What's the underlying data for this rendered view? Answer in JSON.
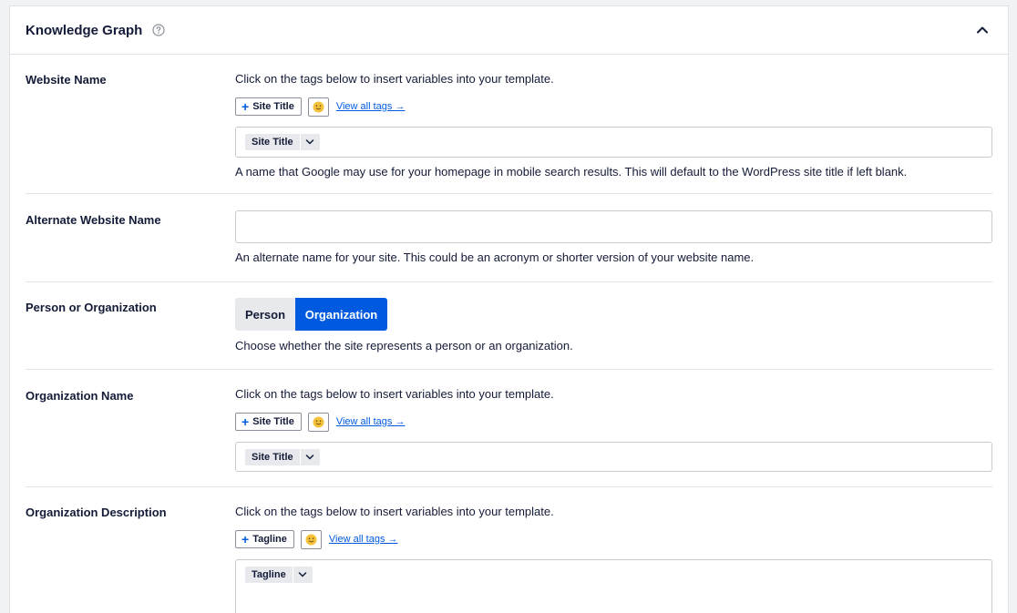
{
  "header": {
    "title": "Knowledge Graph",
    "help_icon": "question-circle-icon",
    "collapse_icon": "chevron-up-icon"
  },
  "website_name": {
    "label": "Website Name",
    "hint": "Click on the tags below to insert variables into your template.",
    "tag_button": "Site Title",
    "emoji_icon": "smiley-emoji-icon",
    "view_all": "View all tags →",
    "chip": "Site Title",
    "description": "A name that Google may use for your homepage in mobile search results. This will default to the WordPress site title if left blank."
  },
  "alternate_name": {
    "label": "Alternate Website Name",
    "value": "",
    "placeholder": "",
    "description": "An alternate name for your site. This could be an acronym or shorter version of your website name."
  },
  "person_org": {
    "label": "Person or Organization",
    "options": [
      "Person",
      "Organization"
    ],
    "selected": "Organization",
    "description": "Choose whether the site represents a person or an organization."
  },
  "org_name": {
    "label": "Organization Name",
    "hint": "Click on the tags below to insert variables into your template.",
    "tag_button": "Site Title",
    "emoji_icon": "smiley-emoji-icon",
    "view_all": "View all tags →",
    "chip": "Site Title"
  },
  "org_description": {
    "label": "Organization Description",
    "hint": "Click on the tags below to insert variables into your template.",
    "tag_button": "Tagline",
    "emoji_icon": "smiley-emoji-icon",
    "view_all": "View all tags →",
    "chip": "Tagline"
  },
  "colors": {
    "accent": "#005ae0",
    "text": "#141b38",
    "border": "#e0e2e7",
    "chip_bg": "#e8e9ed"
  }
}
